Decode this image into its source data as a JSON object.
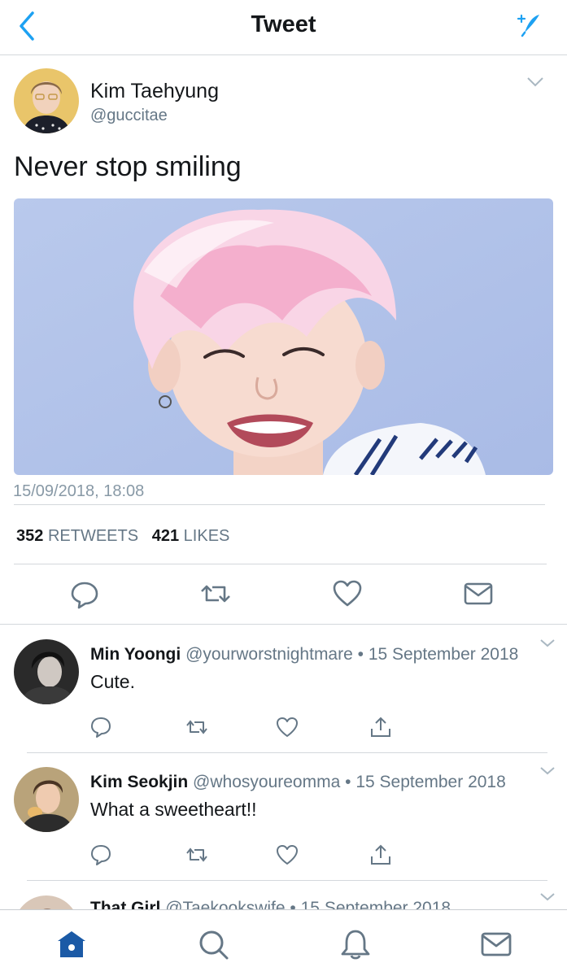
{
  "header": {
    "title": "Tweet"
  },
  "tweet": {
    "name": "Kim Taehyung",
    "handle": "@guccitae",
    "text": "Never stop smiling",
    "timestamp": "15/09/2018, 18:08",
    "retweets_count": "352",
    "retweets_label": "RETWEETS",
    "likes_count": "421",
    "likes_label": "LIKES"
  },
  "replies": [
    {
      "name": "Min Yoongi",
      "handle": "@yourworstnightmare",
      "date": "15 September 2018",
      "text": "Cute."
    },
    {
      "name": "Kim Seokjin",
      "handle": "@whosyoureomma",
      "date": "15 September 2018",
      "text": "What a sweetheart!!"
    },
    {
      "name": "That Girl",
      "handle": "@Taekookswife",
      "date": "15 September 2018",
      "text": ""
    }
  ],
  "dot": "•",
  "colors": {
    "accent": "#1da1f2",
    "icon_gray": "#657786",
    "tab_active": "#1b5aa6",
    "divider": "#d4d8dc"
  },
  "icons": {
    "header": [
      "back-chevron-icon",
      "compose-feather-icon"
    ],
    "tweet_actions": [
      "reply-icon",
      "retweet-icon",
      "like-icon",
      "direct-message-icon"
    ],
    "reply_actions": [
      "reply-icon",
      "retweet-icon",
      "like-icon",
      "share-icon"
    ],
    "tabs": [
      "home-icon",
      "search-icon",
      "notifications-icon",
      "messages-icon"
    ]
  }
}
